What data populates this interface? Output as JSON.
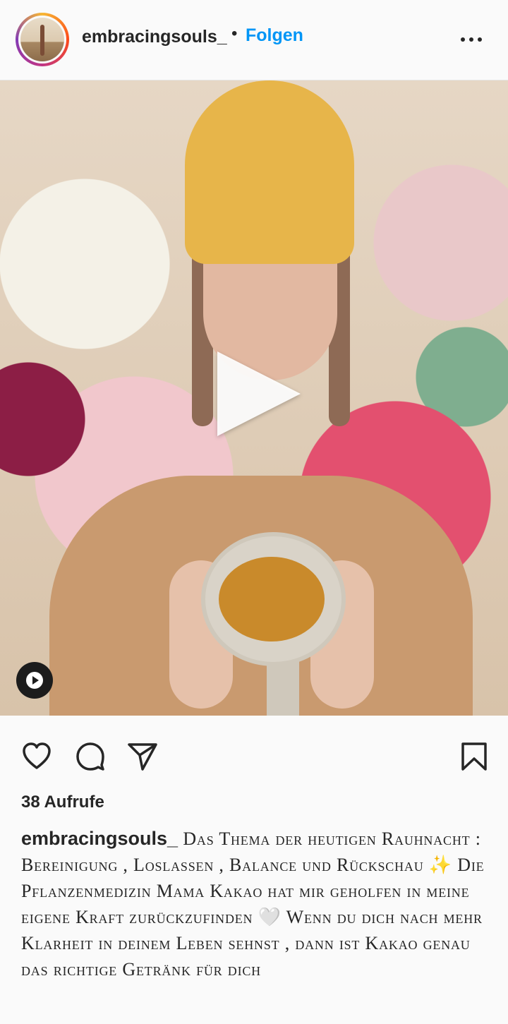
{
  "header": {
    "username": "embracingsouls_",
    "separator": "•",
    "follow_label": "Folgen",
    "more_icon": "more-horizontal-icon"
  },
  "media": {
    "type": "video",
    "play_icon": "play-icon",
    "badge_icon": "reel-icon"
  },
  "actions": {
    "like_icon": "heart-icon",
    "comment_icon": "comment-icon",
    "share_icon": "send-icon",
    "save_icon": "bookmark-icon"
  },
  "stats": {
    "views": "38 Aufrufe"
  },
  "caption": {
    "username": "embracingsouls_",
    "text": "Das Thema der heutigen Rauhnacht : Bereinigung , Loslassen , Balance und Rückschau ✨ Die Pflanzenmedizin Mama Kakao hat mir geholfen in meine eigene Kraft zurückzufinden 🤍 Wenn du dich nach mehr Klarheit in deinem Leben sehnst , dann ist Kakao genau das richtige Getränk für dich"
  },
  "colors": {
    "accent": "#0095f6",
    "text": "#262626",
    "background": "#fafafa"
  }
}
